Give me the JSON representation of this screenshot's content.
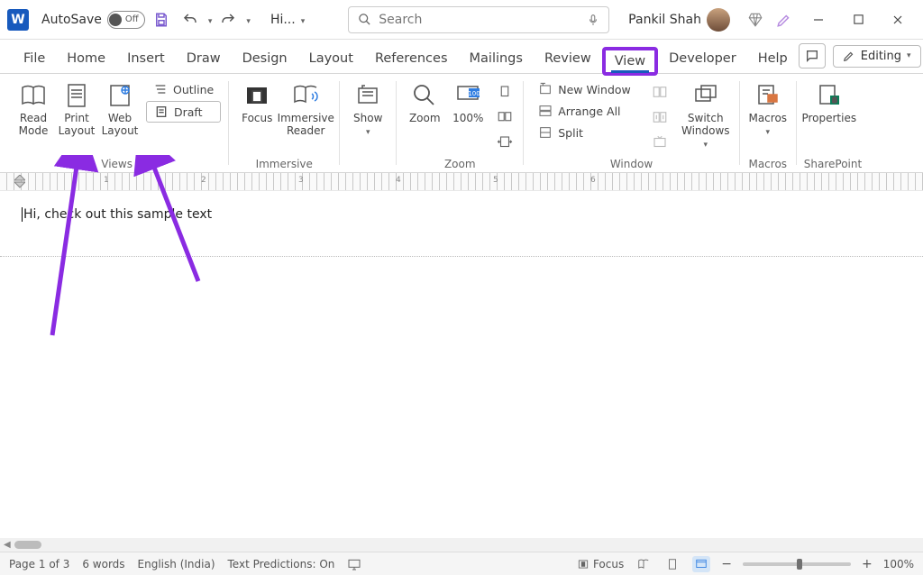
{
  "titlebar": {
    "autosave_label": "AutoSave",
    "autosave_state": "Off",
    "filename_short": "Hi...",
    "search_placeholder": "Search",
    "username": "Pankil Shah"
  },
  "tabs": {
    "file": "File",
    "home": "Home",
    "insert": "Insert",
    "draw": "Draw",
    "design": "Design",
    "layout": "Layout",
    "references": "References",
    "mailings": "Mailings",
    "review": "Review",
    "view": "View",
    "developer": "Developer",
    "help": "Help",
    "editing": "Editing"
  },
  "ribbon": {
    "views": {
      "read_mode": "Read\nMode",
      "print_layout": "Print\nLayout",
      "web_layout": "Web\nLayout",
      "outline": "Outline",
      "draft": "Draft",
      "group": "Views"
    },
    "immersive": {
      "focus": "Focus",
      "immersive_reader": "Immersive\nReader",
      "group": "Immersive"
    },
    "show": {
      "show": "Show",
      "group": ""
    },
    "zoom": {
      "zoom": "Zoom",
      "hundred": "100%",
      "group": "Zoom"
    },
    "window": {
      "new_window": "New Window",
      "arrange_all": "Arrange All",
      "split": "Split",
      "switch_windows": "Switch\nWindows",
      "group": "Window"
    },
    "macros": {
      "macros": "Macros",
      "group": "Macros"
    },
    "sharepoint": {
      "properties": "Properties",
      "group": "SharePoint"
    }
  },
  "ruler_numbers": [
    "1",
    "2",
    "3",
    "4",
    "5",
    "6"
  ],
  "document": {
    "body": "Hi, check out this sample text"
  },
  "statusbar": {
    "page": "Page 1 of 3",
    "words": "6 words",
    "language": "English (India)",
    "predictions": "Text Predictions: On",
    "focus": "Focus",
    "zoom_pct": "100%"
  },
  "annotation": {
    "color": "#8a2be2"
  }
}
